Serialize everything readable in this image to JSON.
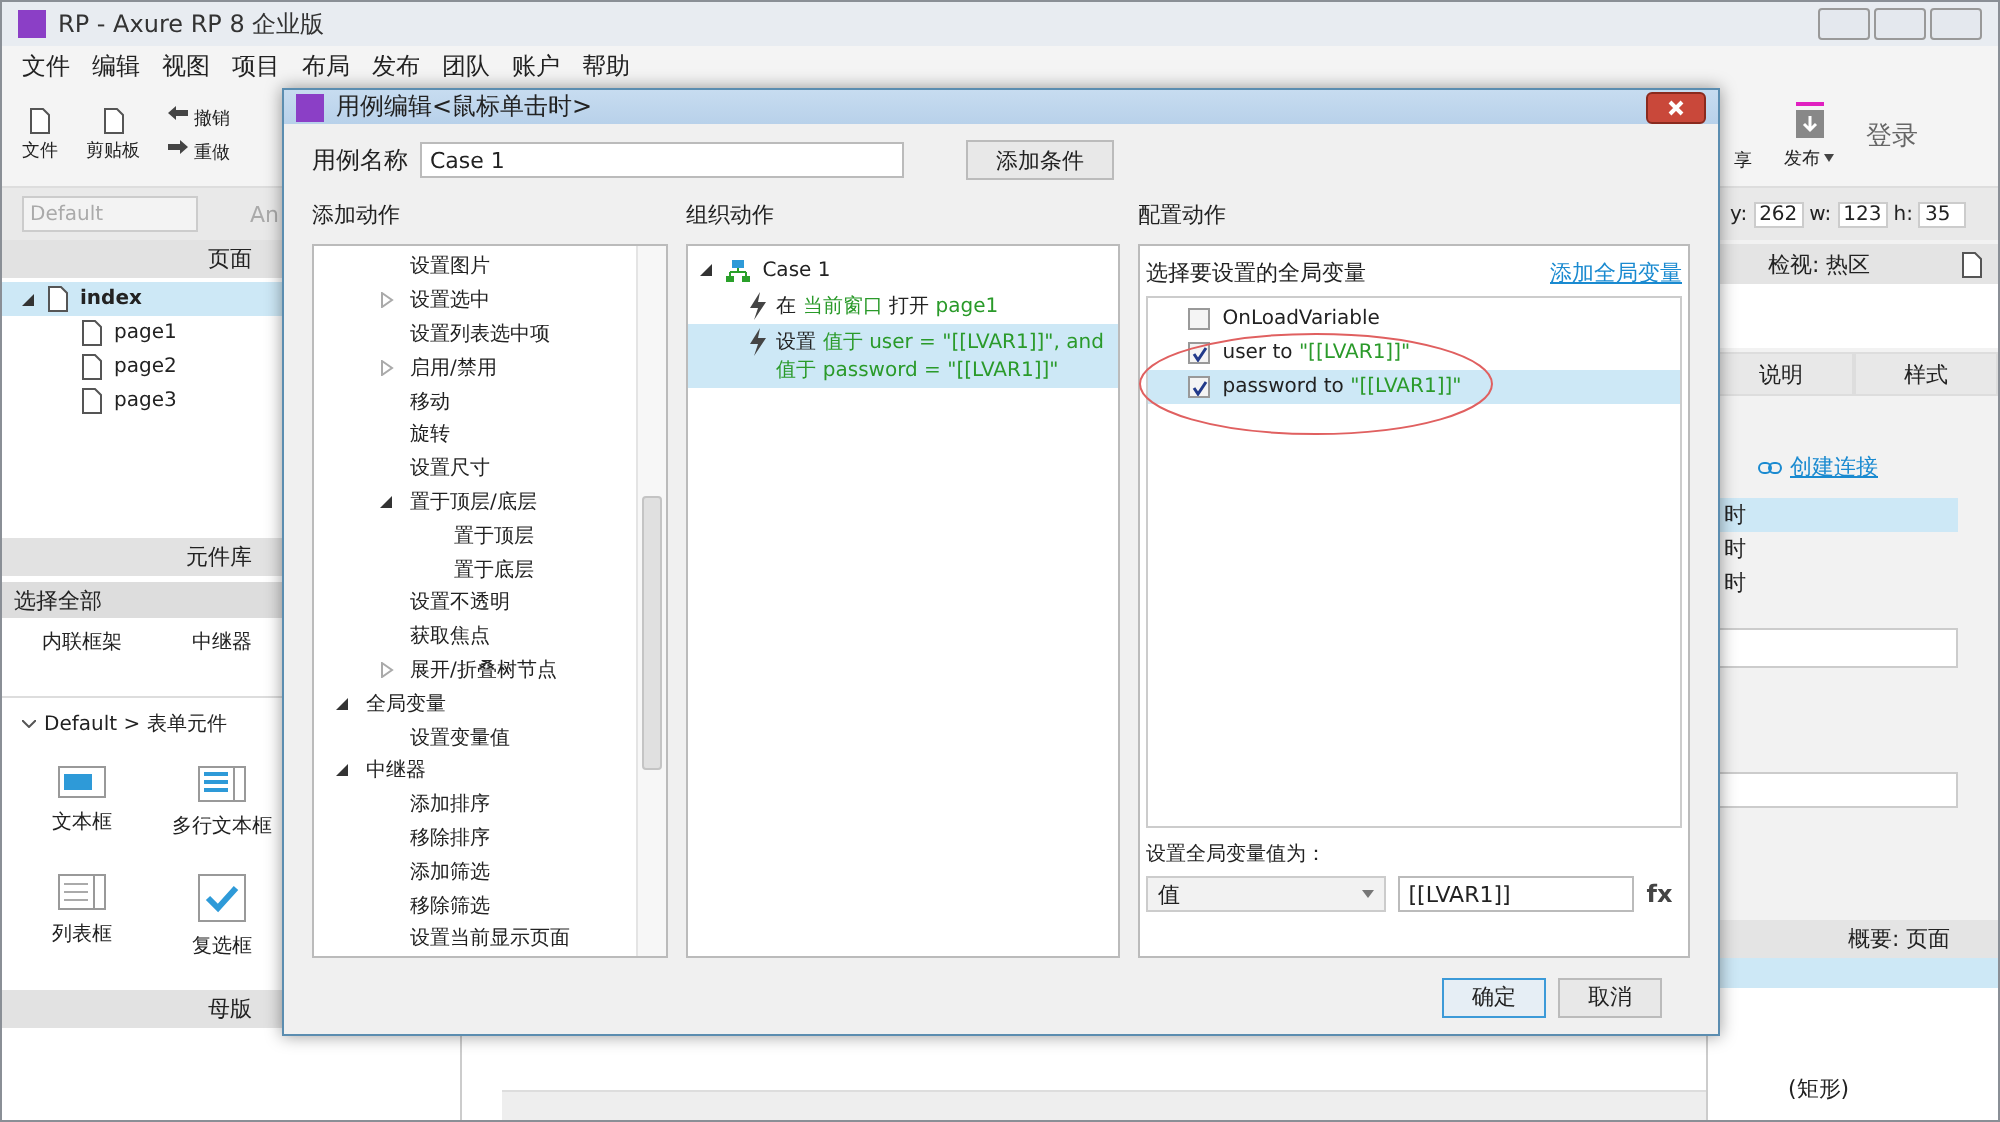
{
  "window": {
    "title": "RP - Axure RP 8 企业版"
  },
  "menu": [
    "文件",
    "编辑",
    "视图",
    "项目",
    "布局",
    "发布",
    "团队",
    "账户",
    "帮助"
  ],
  "toolbar": {
    "file": "文件",
    "clipboard": "剪贴板",
    "undo": "撤销",
    "redo": "重做",
    "share": "享",
    "publish": "发布",
    "login": "登录"
  },
  "style_bar": {
    "style": "Default",
    "font": "An"
  },
  "pages_panel": {
    "title": "页面",
    "tree": [
      {
        "label": "index",
        "selected": true,
        "expanded": true,
        "children": [
          {
            "label": "page1",
            "selected": false
          },
          {
            "label": "page2",
            "selected": false
          },
          {
            "label": "page3",
            "selected": false
          }
        ]
      }
    ]
  },
  "library_panel": {
    "title": "元件库",
    "filter": "选择全部",
    "items": [
      "内联框架",
      "中继器"
    ],
    "group": "Default > 表单元件",
    "widgets": [
      {
        "kind": "textbox",
        "label": "文本框"
      },
      {
        "kind": "textarea",
        "label": "多行文本框"
      },
      {
        "kind": "listbox",
        "label": "列表框"
      },
      {
        "kind": "checkbox",
        "label": "复选框"
      }
    ]
  },
  "masters_panel": {
    "title": "母版"
  },
  "geometry": [
    {
      "label": "y:",
      "value": "262"
    },
    {
      "label": "w:",
      "value": "123"
    },
    {
      "label": "h:",
      "value": "35"
    }
  ],
  "inspector": {
    "title": "检视: 热区",
    "tabs": [
      {
        "label": "说明",
        "selected": false
      },
      {
        "label": "样式",
        "selected": false
      }
    ],
    "link": "创建连接",
    "events": [
      {
        "label": "时",
        "selected": true
      },
      {
        "label": "时",
        "selected": false
      },
      {
        "label": "时",
        "selected": false
      }
    ]
  },
  "outline": {
    "title": "概要: 页面",
    "items": [
      "(矩形)"
    ]
  },
  "dialog": {
    "title": "用例编辑<鼠标单击时>",
    "case_name_label": "用例名称",
    "case_name": "Case 1",
    "add_condition": "添加条件",
    "add_action": {
      "title": "添加动作",
      "tree": [
        {
          "children": [
            {
              "label": "设置图片"
            },
            {
              "label": "设置选中",
              "expanded": false
            },
            {
              "label": "设置列表选中项"
            },
            {
              "label": "启用/禁用",
              "expanded": false
            },
            {
              "label": "移动"
            },
            {
              "label": "旋转"
            },
            {
              "label": "设置尺寸"
            },
            {
              "label": "置于顶层/底层",
              "expanded": true,
              "children": [
                {
                  "label": "置于顶层"
                },
                {
                  "label": "置于底层"
                }
              ]
            },
            {
              "label": "设置不透明"
            },
            {
              "label": "获取焦点"
            },
            {
              "label": "展开/折叠树节点",
              "expanded": false
            }
          ]
        },
        {
          "label": "全局变量",
          "expanded": true,
          "children": [
            {
              "label": "设置变量值"
            }
          ]
        },
        {
          "label": "中继器",
          "expanded": true,
          "children": [
            {
              "label": "添加排序"
            },
            {
              "label": "移除排序"
            },
            {
              "label": "添加筛选"
            },
            {
              "label": "移除筛选"
            },
            {
              "label": "设置当前显示页面"
            }
          ]
        }
      ]
    },
    "organize": {
      "title": "组织动作",
      "case": {
        "label": "Case 1",
        "expanded": true,
        "actions": [
          {
            "selected": false,
            "lines": [
              [
                {
                  "text": "在 ",
                  "highlight": false
                },
                {
                  "text": "当前窗口",
                  "highlight": true
                },
                {
                  "text": " 打开 ",
                  "highlight": false
                },
                {
                  "text": "page1",
                  "highlight": true
                }
              ]
            ]
          },
          {
            "selected": true,
            "lines": [
              [
                {
                  "text": "设置 ",
                  "highlight": false
                },
                {
                  "text": "值于 user = \"[[LVAR1]]\", and",
                  "highlight": true
                }
              ],
              [
                {
                  "text": "值于 password = \"[[LVAR1]]\"",
                  "highlight": true
                }
              ]
            ]
          }
        ]
      }
    },
    "configure": {
      "title": "配置动作",
      "prompt": "选择要设置的全局变量",
      "add_link": "添加全局变量",
      "variables": [
        {
          "name": "OnLoadVariable",
          "checked": false,
          "selected": false
        },
        {
          "name": "user to ",
          "value": "\"[[LVAR1]]\"",
          "checked": true,
          "selected": false
        },
        {
          "name": "password to ",
          "value": "\"[[LVAR1]]\"",
          "checked": true,
          "selected": true
        }
      ],
      "value_label": "设置全局变量值为：",
      "value_type": "值",
      "value": "[[LVAR1]]",
      "fx": "fx"
    },
    "buttons": [
      {
        "label": "确定",
        "kind": "primary"
      },
      {
        "label": "取消",
        "kind": "normal"
      }
    ]
  }
}
